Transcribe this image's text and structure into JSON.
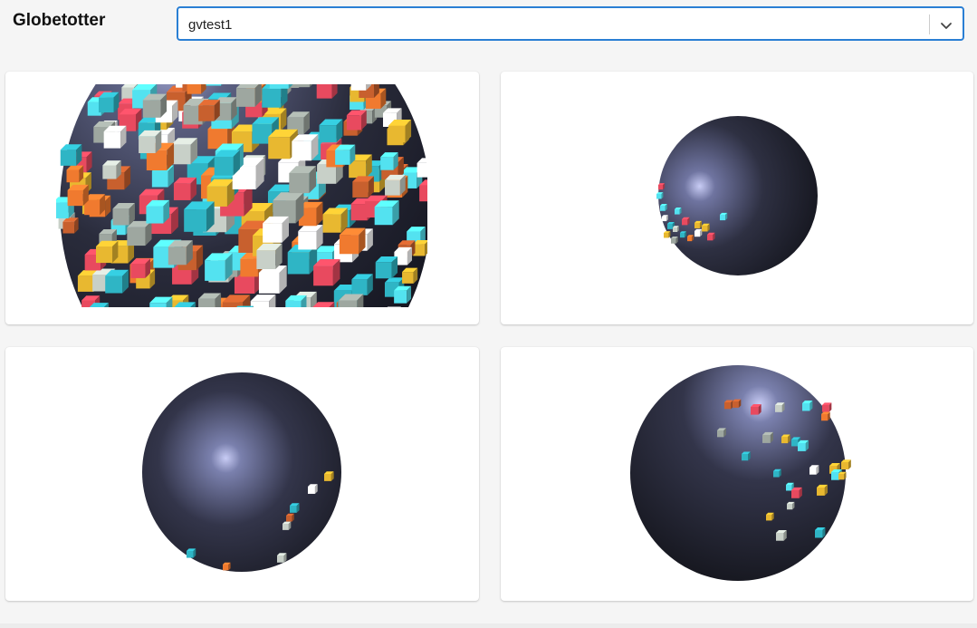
{
  "header": {
    "title": "Globetotter",
    "dataset_select": {
      "value": "gvtest1",
      "chevron_icon": "chevron-down-icon"
    }
  },
  "colors": {
    "accent": "#2a7fd4",
    "globe_dark": "#1e1f2b",
    "globe_highlight": "#b5b9e8",
    "cube_palette": [
      "#e84a5f",
      "#f07a2f",
      "#e8b830",
      "#2fb5c5",
      "#c8d0c8",
      "#9ea7a0",
      "#c8602e",
      "#53e2f0",
      "#ffffff"
    ]
  },
  "views": [
    {
      "name": "globe-view-1",
      "zoom_level": "close"
    },
    {
      "name": "globe-view-2",
      "zoom_level": "far"
    },
    {
      "name": "globe-view-3",
      "zoom_level": "medium"
    },
    {
      "name": "globe-view-4",
      "zoom_level": "medium"
    }
  ]
}
